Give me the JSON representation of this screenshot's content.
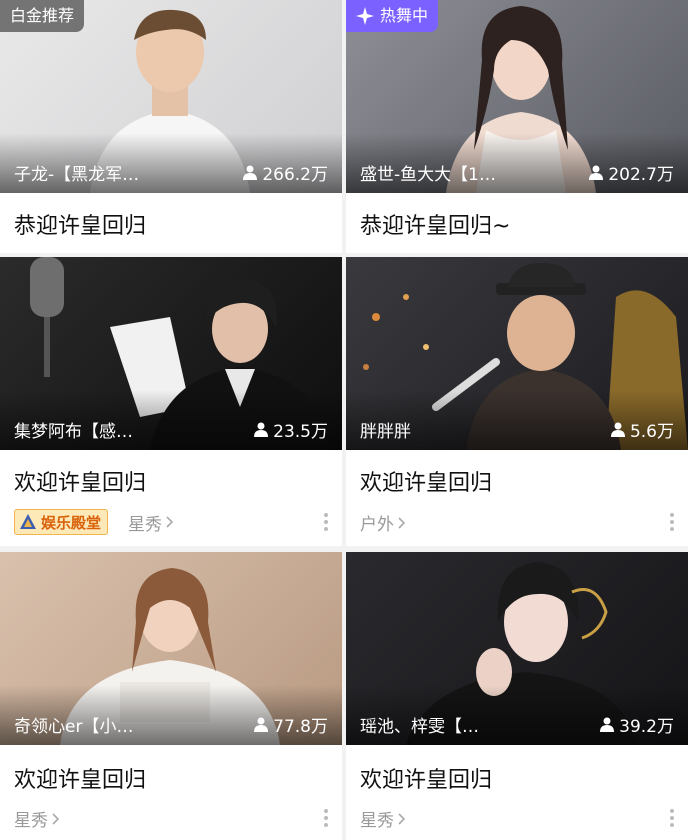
{
  "cards": [
    {
      "badge": "白金推荐",
      "streamer": "子龙-【黑龙军…",
      "viewers": "266.2万",
      "title": "恭迎许皇回归"
    },
    {
      "badge": "热舞中",
      "streamer": "盛世-鱼大大【1…",
      "viewers": "202.7万",
      "title": "恭迎许皇回归~"
    },
    {
      "streamer": "集梦阿布【感…",
      "viewers": "23.5万",
      "title": "欢迎许皇回归",
      "tag": "娱乐殿堂",
      "category": "星秀"
    },
    {
      "streamer": "胖胖胖",
      "viewers": "5.6万",
      "title": "欢迎许皇回归",
      "category": "户外"
    },
    {
      "streamer": "奇领心er【小…",
      "viewers": "77.8万",
      "title": "欢迎许皇回归",
      "category": "星秀"
    },
    {
      "streamer": "瑶池、梓雯【…",
      "viewers": "39.2万",
      "title": "欢迎许皇回归",
      "category": "星秀"
    }
  ],
  "icons": {
    "viewer": "person-icon",
    "badge_hot": "sparkle-icon",
    "category_more": "chevron-right-icon",
    "menu": "more-vertical-icon",
    "tag": "entertainment-hall-icon"
  },
  "colors": {
    "page_bg": "#f2f2f2",
    "card_bg": "#ffffff",
    "badge_purple": "#7b61ff",
    "tag_bg": "#fde9b8",
    "tag_text": "#d9630b",
    "meta_text": "#999999"
  }
}
